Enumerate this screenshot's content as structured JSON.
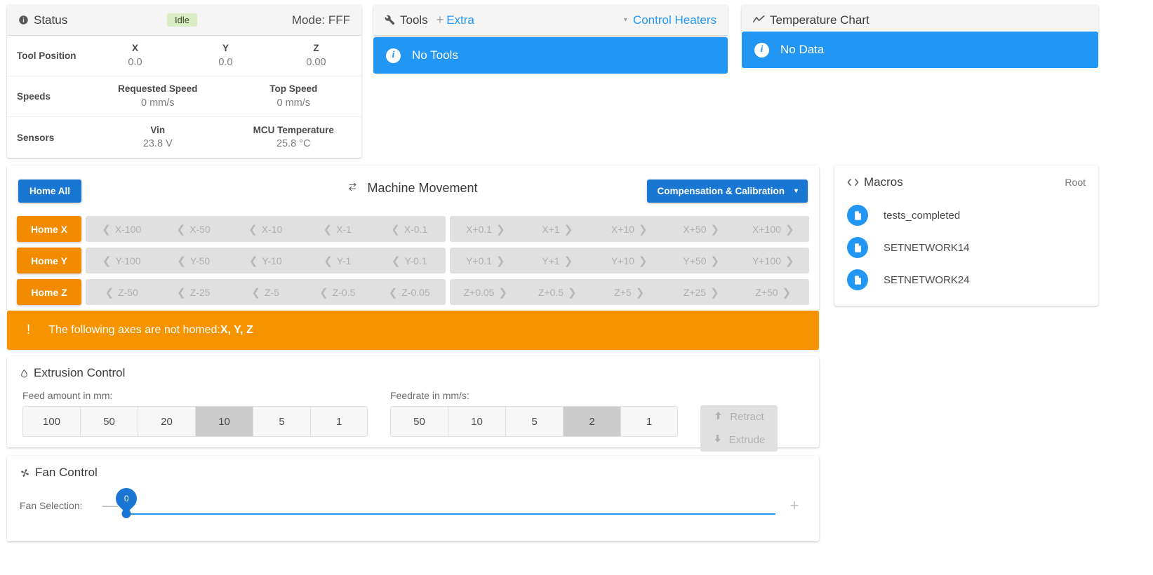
{
  "status": {
    "title": "Status",
    "badge": "Idle",
    "mode": "Mode: FFF",
    "rows": [
      {
        "label": "Tool Position",
        "cells": [
          {
            "title": "X",
            "value": "0.0"
          },
          {
            "title": "Y",
            "value": "0.0"
          },
          {
            "title": "Z",
            "value": "0.00"
          }
        ]
      },
      {
        "label": "Speeds",
        "cells": [
          {
            "title": "Requested Speed",
            "value": "0 mm/s"
          },
          {
            "title": "Top Speed",
            "value": "0 mm/s"
          }
        ]
      },
      {
        "label": "Sensors",
        "cells": [
          {
            "title": "Vin",
            "value": "23.8 V"
          },
          {
            "title": "MCU Temperature",
            "value": "25.8 °C"
          }
        ]
      }
    ]
  },
  "tools": {
    "title": "Tools",
    "extra_label": "Extra",
    "control_heaters_label": "Control Heaters",
    "alert": "No Tools"
  },
  "temperature_chart": {
    "title": "Temperature Chart",
    "alert": "No Data"
  },
  "movement": {
    "title": "Machine Movement",
    "home_all_label": "Home All",
    "compensation_label": "Compensation & Calibration",
    "axes": [
      {
        "home_label": "Home X",
        "negative": [
          "X-100",
          "X-50",
          "X-10",
          "X-1",
          "X-0.1"
        ],
        "positive": [
          "X+0.1",
          "X+1",
          "X+10",
          "X+50",
          "X+100"
        ]
      },
      {
        "home_label": "Home Y",
        "negative": [
          "Y-100",
          "Y-50",
          "Y-10",
          "Y-1",
          "Y-0.1"
        ],
        "positive": [
          "Y+0.1",
          "Y+1",
          "Y+10",
          "Y+50",
          "Y+100"
        ]
      },
      {
        "home_label": "Home Z",
        "negative": [
          "Z-50",
          "Z-25",
          "Z-5",
          "Z-0.5",
          "Z-0.05"
        ],
        "positive": [
          "Z+0.05",
          "Z+0.5",
          "Z+5",
          "Z+25",
          "Z+50"
        ]
      }
    ]
  },
  "warning": {
    "text_prefix": "The following axes are not homed: ",
    "axes": "X, Y, Z"
  },
  "extrusion": {
    "title": "Extrusion Control",
    "feed_amount_label": "Feed amount in mm:",
    "feed_amounts": [
      "100",
      "50",
      "20",
      "10",
      "5",
      "1"
    ],
    "feed_amount_selected": "10",
    "feedrate_label": "Feedrate in mm/s:",
    "feedrates": [
      "50",
      "10",
      "5",
      "2",
      "1"
    ],
    "feedrate_selected": "2",
    "retract_label": "Retract",
    "extrude_label": "Extrude"
  },
  "fan": {
    "title": "Fan Control",
    "selection_label": "Fan Selection:",
    "value": "0",
    "minus_label": "—",
    "plus_label": "+"
  },
  "macros": {
    "title": "Macros",
    "root_label": "Root",
    "items": [
      {
        "name": "tests_completed"
      },
      {
        "name": "SETNETWORK14"
      },
      {
        "name": "SETNETWORK24"
      }
    ]
  },
  "colors": {
    "primary_blue": "#2196f3",
    "dark_blue": "#1976d2",
    "orange": "#f38b00",
    "warning_orange": "#f59300",
    "idle_green": "#d9ecc4"
  }
}
